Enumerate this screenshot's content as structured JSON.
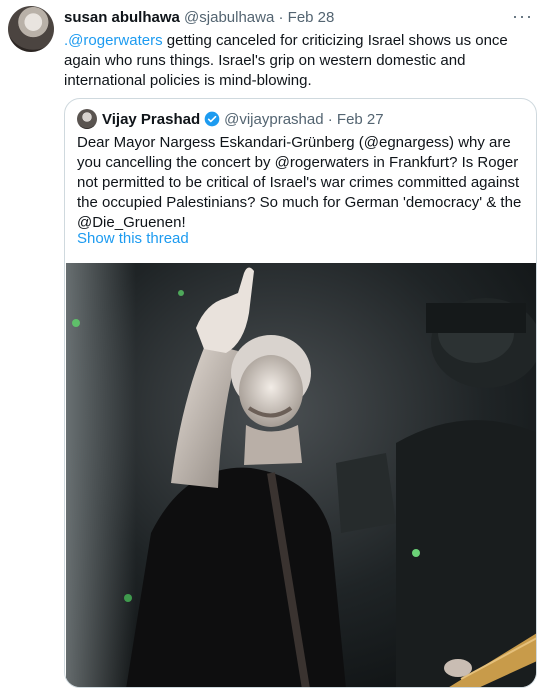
{
  "tweet": {
    "author_name": "susan abulhawa",
    "handle": "@sjabulhawa",
    "date": "Feb 28",
    "more_label": "···",
    "mention": ".@rogerwaters",
    "text_after_mention": " getting canceled for criticizing Israel shows us once again who runs things. Israel's grip on western domestic and international policies is mind-blowing."
  },
  "quote": {
    "author_name": "Vijay Prashad",
    "handle": "@vijayprashad",
    "date": "Feb 27",
    "text": "Dear Mayor Nargess Eskandari-Grünberg (@egnargess) why are you cancelling the concert by @rogerwaters in Frankfurt? Is Roger not permitted to be critical of Israel's war crimes committed against the occupied Palestinians? So much for German 'democracy' & the @Die_Gruenen!",
    "show_thread_label": "Show this thread"
  },
  "icons": {
    "avatar": "profile-photo-icon",
    "verified": "verified-badge-icon",
    "more": "more-options-icon"
  },
  "colors": {
    "link": "#1d9bf0",
    "secondary_text": "#536471",
    "border": "#cfd9de"
  }
}
